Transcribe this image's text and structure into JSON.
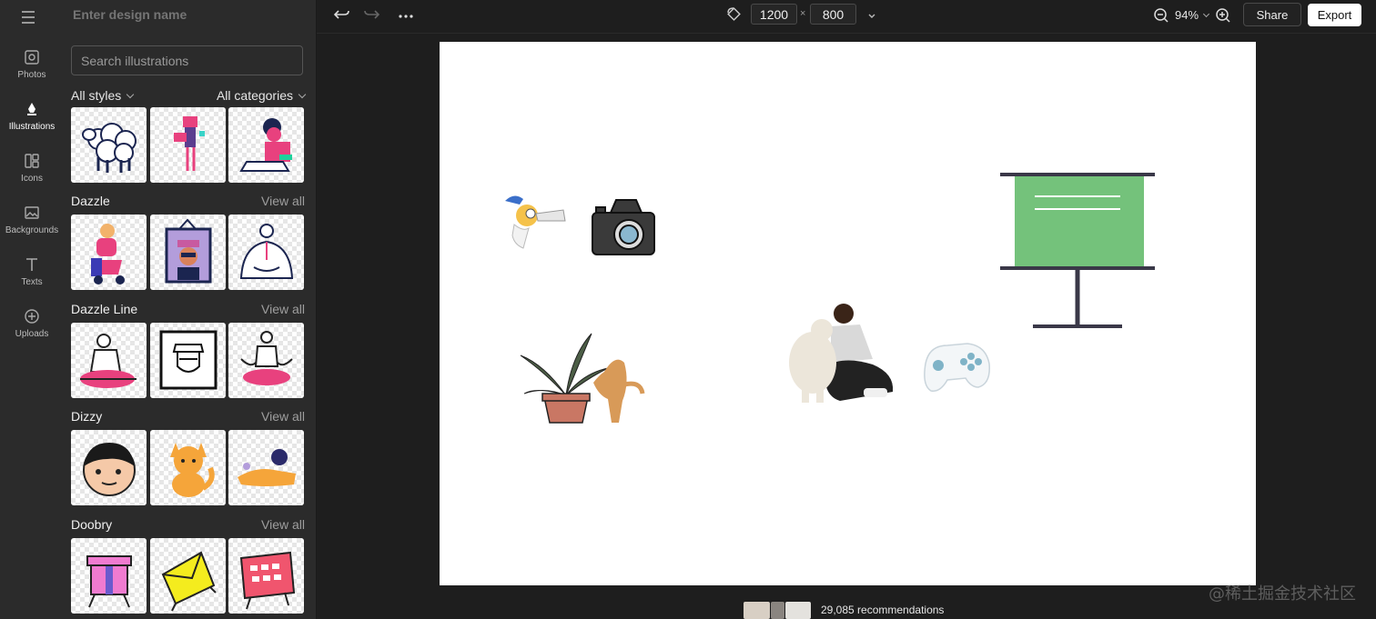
{
  "design_name_placeholder": "Enter design name",
  "sidebar": {
    "items": [
      {
        "label": "Photos",
        "icon": "photos-icon"
      },
      {
        "label": "Illustrations",
        "icon": "illustrations-icon"
      },
      {
        "label": "Icons",
        "icon": "icons-icon"
      },
      {
        "label": "Backgrounds",
        "icon": "backgrounds-icon"
      },
      {
        "label": "Texts",
        "icon": "texts-icon"
      },
      {
        "label": "Uploads",
        "icon": "uploads-icon"
      }
    ],
    "active": "Illustrations"
  },
  "panel": {
    "search_placeholder": "Search illustrations",
    "filters": {
      "styles": "All styles",
      "categories": "All categories"
    },
    "sections": [
      {
        "title": "Dazzle",
        "view_all": "View all"
      },
      {
        "title": "Dazzle Line",
        "view_all": "View all"
      },
      {
        "title": "Dizzy",
        "view_all": "View all"
      },
      {
        "title": "Doobry",
        "view_all": "View all"
      }
    ]
  },
  "toolbar": {
    "width": "1200",
    "height": "800",
    "times": "×",
    "zoom": "94%",
    "share_label": "Share",
    "export_label": "Export"
  },
  "bottom": {
    "recommendations": "29,085 recommendations",
    "watermark": "@稀土掘金技术社区"
  },
  "colors": {
    "background": "#1e1e1e",
    "panel": "#2b2b2b",
    "canvas": "#ffffff",
    "board_green": "#74c27b",
    "board_frame": "#3a3848"
  }
}
